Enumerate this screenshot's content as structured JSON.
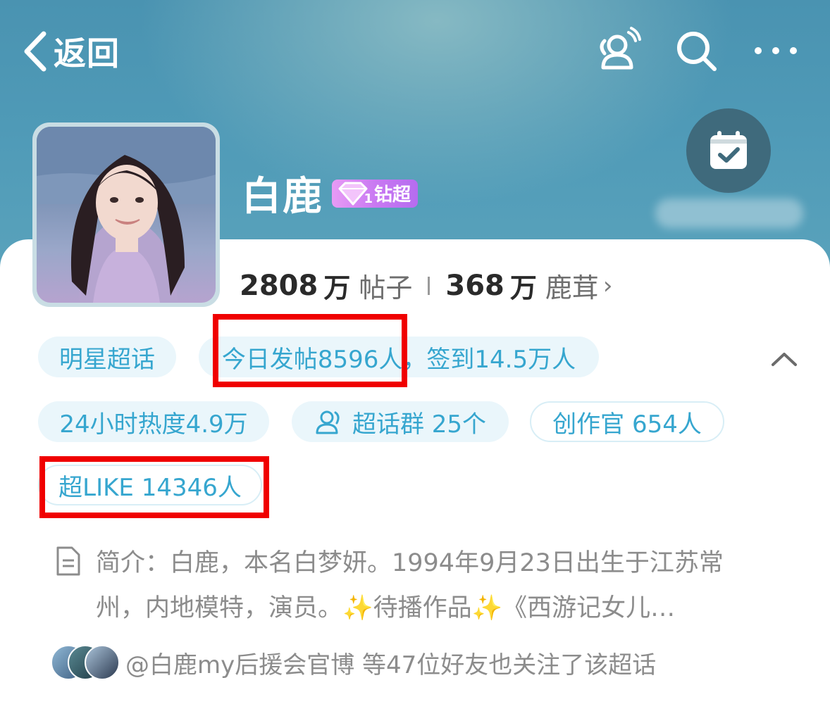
{
  "nav": {
    "back_label": "返回"
  },
  "topic": {
    "name": "白鹿",
    "badge_level": "1",
    "badge_label": "钻超"
  },
  "stats": {
    "posts_num": "2808",
    "posts_unit": "万",
    "posts_label": "帖子",
    "fans_num": "368",
    "fans_unit": "万",
    "fans_label": "鹿茸"
  },
  "chips": {
    "category": "明星超话",
    "today": "今日发帖8596人，签到14.5万人",
    "heat": "24小时热度4.9万",
    "group": "超话群 25个",
    "creators": "创作官 654人",
    "superlike": "超LIKE 14346人"
  },
  "intro": {
    "text": "简介：白鹿，本名白梦妍。1994年9月23日出生于江苏常州，内地模特，演员。✨待播作品✨《西游记女儿…"
  },
  "friends": {
    "text": "@白鹿my后援会官博 等47位好友也关注了该超话"
  },
  "colors": {
    "accent": "#36a6cf",
    "chip_bg": "#eaf6fb",
    "highlight_box": "#f00000",
    "header_bg": "#4f9ab7"
  },
  "icons": [
    "back-arrow-icon",
    "friends-icon",
    "search-icon",
    "more-icon",
    "calendar-check-icon",
    "diamond-icon",
    "group-icon",
    "collapse-icon",
    "document-icon"
  ]
}
